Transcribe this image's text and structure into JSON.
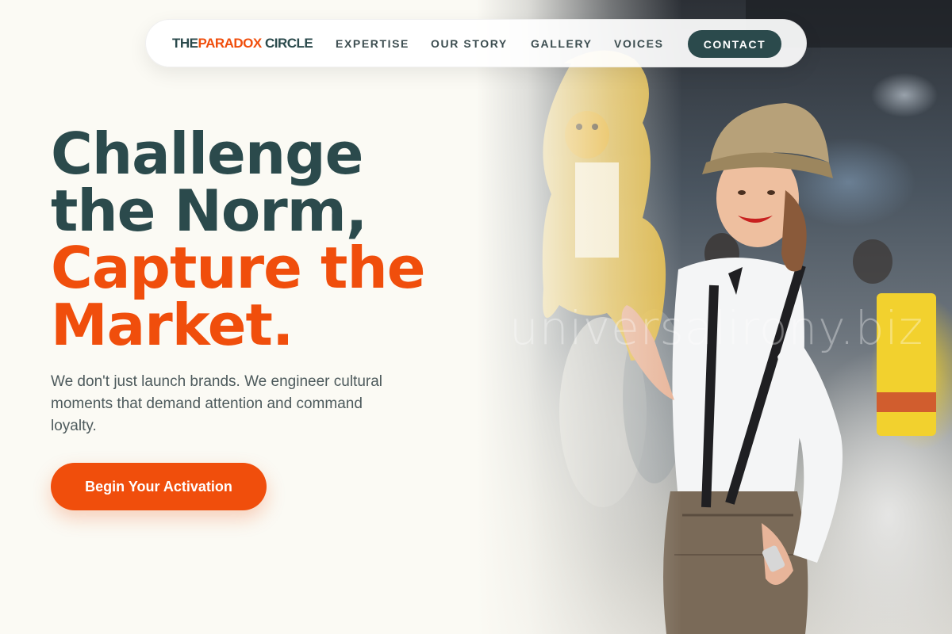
{
  "nav": {
    "logo": {
      "part1": "THE",
      "part2": "PARADOX",
      "part3": "CIRCLE"
    },
    "links": [
      "EXPERTISE",
      "OUR STORY",
      "GALLERY",
      "VOICES"
    ],
    "cta_label": "CONTACT"
  },
  "hero": {
    "headline_line1": "Challenge",
    "headline_line2": "the Norm,",
    "headline_line3": "Capture the",
    "headline_line4": "Market.",
    "subcopy": "We don't just launch brands. We engineer cultural moments that demand attention and command loyalty.",
    "cta_label": "Begin Your Activation"
  },
  "image": {
    "icon": "hero-photo-promoter",
    "watermark": "universalirony.biz"
  },
  "colors": {
    "background": "#fbfaf4",
    "brand_dark": "#2b4a4c",
    "brand_orange": "#f04e0c",
    "body_text": "#4d5a5c"
  }
}
